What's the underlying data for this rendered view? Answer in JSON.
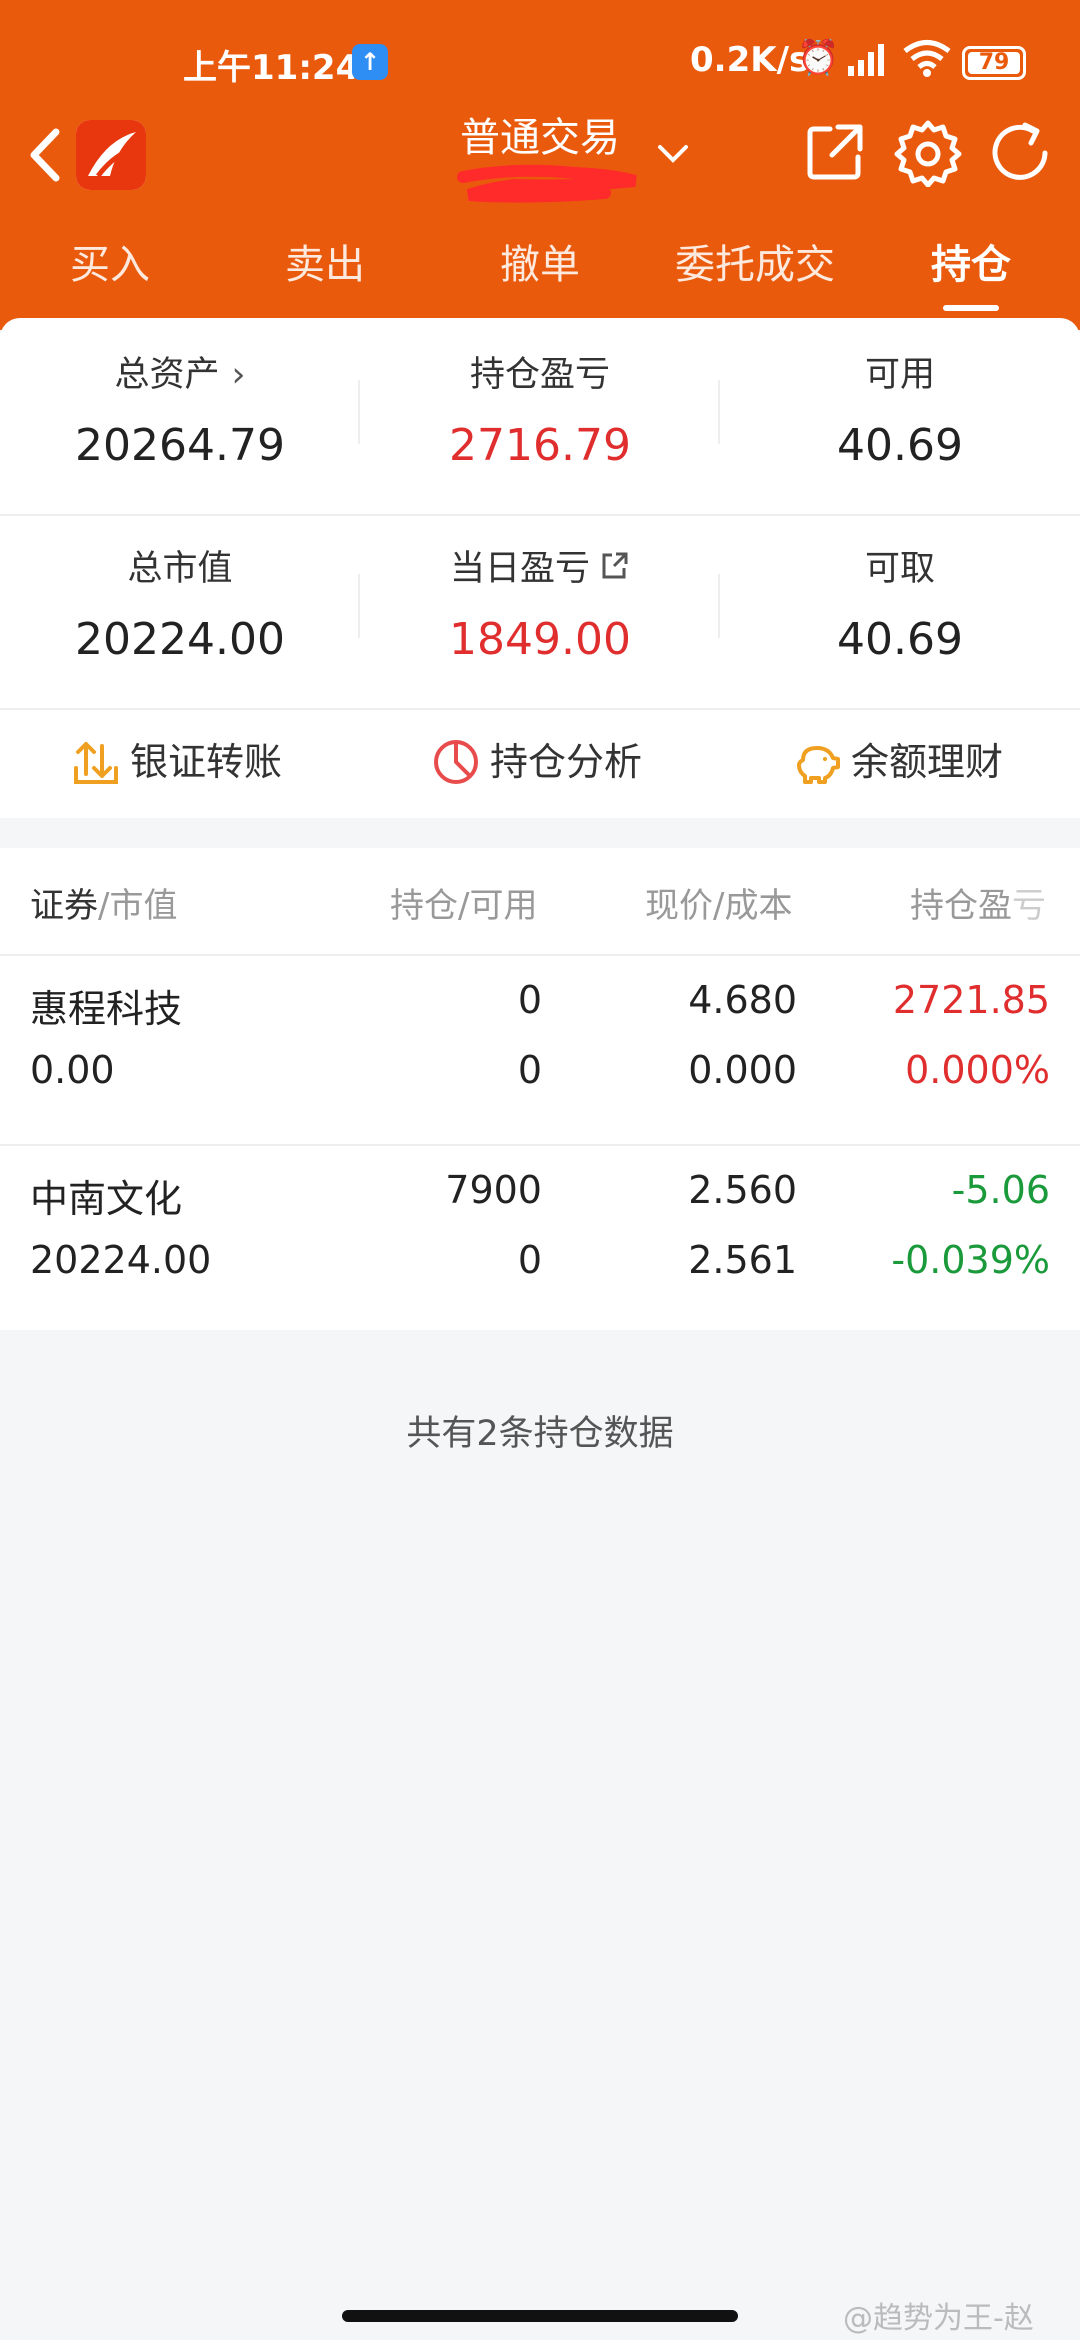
{
  "status_bar": {
    "time": "上午11:24",
    "network_speed": "0.2K/s",
    "battery": "79",
    "icons": [
      "upload-icon",
      "alarm-icon",
      "signal-icon",
      "wifi-icon",
      "battery-icon"
    ]
  },
  "nav": {
    "title": "普通交易",
    "icons": [
      "back-icon",
      "app-logo",
      "chevron-down-icon",
      "export-icon",
      "gear-icon",
      "refresh-icon"
    ]
  },
  "tabs": [
    {
      "label": "买入",
      "active": false
    },
    {
      "label": "卖出",
      "active": false
    },
    {
      "label": "撤单",
      "active": false
    },
    {
      "label": "委托成交",
      "active": false
    },
    {
      "label": "持仓",
      "active": true
    }
  ],
  "summary": {
    "total_assets": {
      "label": "总资产",
      "value": "20264.79"
    },
    "position_pnl": {
      "label": "持仓盈亏",
      "value": "2716.79"
    },
    "available": {
      "label": "可用",
      "value": "40.69"
    },
    "market_value": {
      "label": "总市值",
      "value": "20224.00"
    },
    "daily_pnl": {
      "label": "当日盈亏",
      "value": "1849.00"
    },
    "withdrawable": {
      "label": "可取",
      "value": "40.69"
    }
  },
  "actions": [
    {
      "label": "银证转账",
      "icon": "transfer-icon"
    },
    {
      "label": "持仓分析",
      "icon": "pie-chart-icon"
    },
    {
      "label": "余额理财",
      "icon": "piggy-bank-icon"
    }
  ],
  "table": {
    "headers": {
      "security": "证券",
      "market_value": "/市值",
      "position": "持仓/可用",
      "price": "现价/成本",
      "pnl_main": "持仓盈",
      "pnl_end": "亏"
    },
    "rows": [
      {
        "name": "惠程科技",
        "market_value": "0.00",
        "position": "0",
        "available": "0",
        "price": "4.680",
        "cost": "0.000",
        "pnl": "2721.85",
        "pnl_pct": "0.000%",
        "trend": "up"
      },
      {
        "name": "中南文化",
        "market_value": "20224.00",
        "position": "7900",
        "available": "0",
        "price": "2.560",
        "cost": "2.561",
        "pnl": "-5.06",
        "pnl_pct": "-0.039%",
        "trend": "down"
      }
    ]
  },
  "footer": {
    "text": "共有2条持仓数据"
  },
  "watermark": "@趋势为王-赵",
  "colors": {
    "brand": "#ea5a0c",
    "up": "#e02d2d",
    "down": "#1a9a3a",
    "action_icon": "#f0a020",
    "pie_icon": "#e84b4b",
    "redaction": "#ff2a2a"
  }
}
